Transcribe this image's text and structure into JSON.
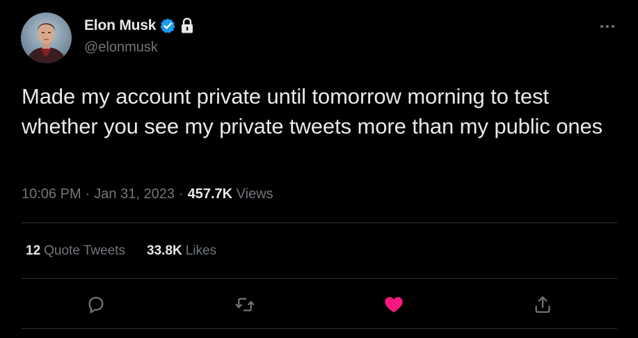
{
  "author": {
    "name": "Elon Musk",
    "handle": "@elonmusk"
  },
  "tweet": {
    "text": "Made my account private until tomorrow morning to test whether you see my private tweets more than my public ones",
    "time": "10:06 PM",
    "date": "Jan 31, 2023",
    "view_count": "457.7K",
    "views_label": "Views"
  },
  "stats": {
    "quote_count": "12",
    "quote_label": "Quote Tweets",
    "like_count": "33.8K",
    "like_label": "Likes"
  },
  "icons": {
    "verified": "verified-badge-icon",
    "lock": "lock-icon",
    "more": "more-icon",
    "reply": "reply-icon",
    "retweet": "retweet-icon",
    "like": "heart-icon",
    "share": "share-icon"
  },
  "colors": {
    "background": "#000000",
    "text": "#e7e9ea",
    "secondary": "#71767b",
    "divider": "#2f3336",
    "verified": "#1d9bf0",
    "liked": "#f91880"
  }
}
